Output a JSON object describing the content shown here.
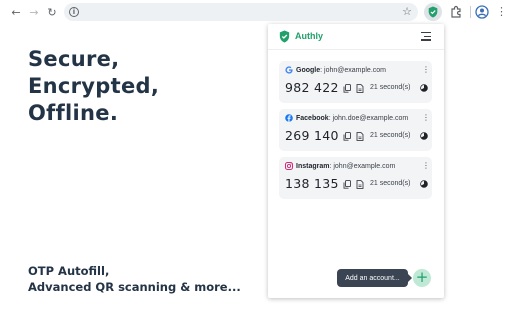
{
  "browser": {
    "back_icon": "arrow-left-icon",
    "forward_icon": "arrow-right-icon",
    "reload_icon": "reload-icon",
    "address_value": ""
  },
  "hero": {
    "line1": "Secure,",
    "line2": "Encrypted,",
    "line3": "Offline."
  },
  "subtitle": {
    "line1": "OTP Autofill,",
    "line2": "Advanced QR scanning & more..."
  },
  "popup": {
    "brand": "Authly",
    "accent_color": "#22a06b",
    "accounts": [
      {
        "service": "Google",
        "account": ": john@example.com",
        "code": "982 422",
        "timer": "21 second(s)",
        "icon": "google-icon"
      },
      {
        "service": "Facebook",
        "account": ": john.doe@example.com",
        "code": "269 140",
        "timer": "21 second(s)",
        "icon": "facebook-icon"
      },
      {
        "service": "Instagram",
        "account": ": john@example.com",
        "code": "138 135",
        "timer": "21 second(s)",
        "icon": "instagram-icon"
      }
    ],
    "tooltip": "Add an account...",
    "fab_label": "+"
  }
}
